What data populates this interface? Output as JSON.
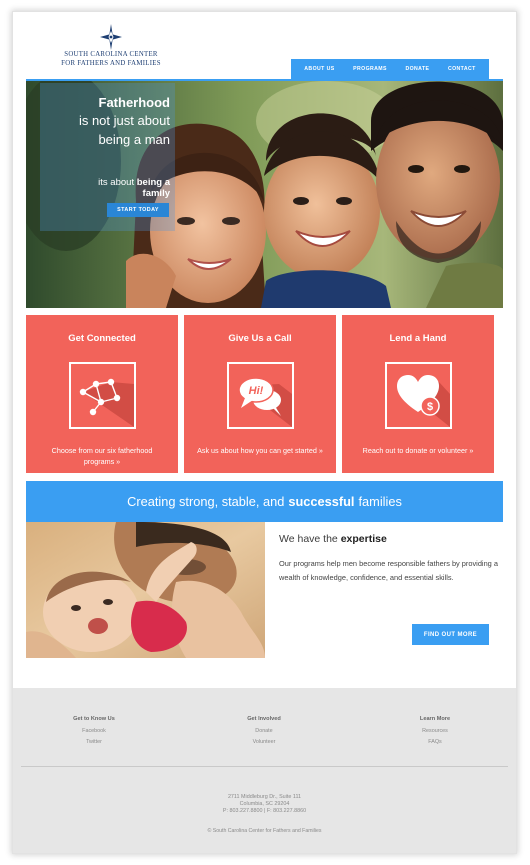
{
  "brand": {
    "logo_line1": "SOUTH CAROLINA CENTER",
    "logo_line2": "FOR FATHERS AND FAMILIES",
    "color_primary": "#3a9ef2",
    "color_card": "#f2635a",
    "color_logo": "#1e3f73"
  },
  "nav": {
    "items": [
      {
        "label": "ABOUT US"
      },
      {
        "label": "PROGRAMS"
      },
      {
        "label": "DONATE"
      },
      {
        "label": "CONTACT"
      }
    ]
  },
  "hero": {
    "line1": "Fatherhood",
    "line2": "is not just about",
    "line3": "being a man",
    "line4_prefix": "its about",
    "line4_bold": "being a",
    "line5": "family",
    "button": "START TODAY"
  },
  "cards": [
    {
      "title": "Get Connected",
      "icon": "network-icon",
      "link_text": "Choose from our six fatherhood programs »"
    },
    {
      "title": "Give Us a Call",
      "icon": "speech-bubble-icon",
      "icon_text": "Hi!",
      "link_text": "Ask us about how you can get started »"
    },
    {
      "title": "Lend a Hand",
      "icon": "heart-dollar-icon",
      "icon_text": "$",
      "link_text": "Reach out to donate or volunteer »"
    }
  ],
  "banner": {
    "prefix": "Creating strong, stable, and",
    "bold": "successful",
    "suffix": "families"
  },
  "expertise": {
    "heading_prefix": "We have the",
    "heading_bold": "expertise",
    "body": "Our programs help men become responsible fathers by providing a wealth of knowledge, confidence, and essential skills.",
    "button": "FIND OUT MORE"
  },
  "footer": {
    "columns": [
      {
        "heading": "Get to Know Us",
        "links": [
          "Facebook",
          "Twitter"
        ]
      },
      {
        "heading": "Get Involved",
        "links": [
          "Donate",
          "Volunteer"
        ]
      },
      {
        "heading": "Learn More",
        "links": [
          "Resources",
          "FAQs"
        ]
      }
    ],
    "address_line1": "2711 Middleburg Dr., Suite 111",
    "address_line2": "Columbia, SC 29204",
    "address_line3": "P: 803.227.8800 | F: 803.227.8860",
    "copyright": "© South Carolina Center for Fathers and Families"
  }
}
